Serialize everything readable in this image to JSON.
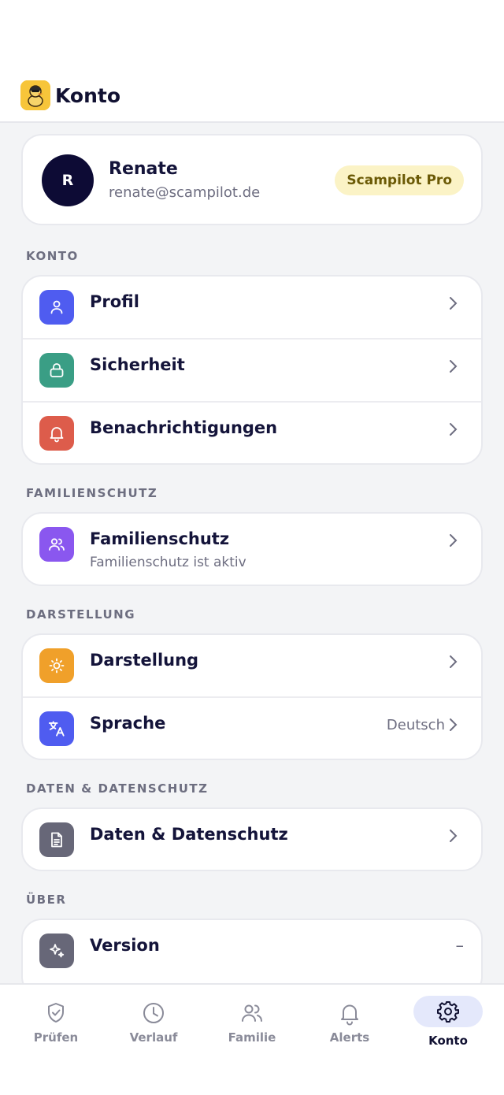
{
  "app": {
    "title": "Konto",
    "logo_icon": "duck-logo-icon"
  },
  "profile": {
    "avatar_initial": "R",
    "name": "Renate",
    "email": "renate@scampilot.de",
    "badge": "Scampilot Pro"
  },
  "sections": {
    "konto": {
      "label": "KONTO",
      "items": [
        {
          "label": "Profil",
          "icon": "user-icon",
          "color": "#4f5cf0"
        },
        {
          "label": "Sicherheit",
          "icon": "lock-icon",
          "color": "#3a9e85"
        },
        {
          "label": "Benachrichtigungen",
          "icon": "bell-icon",
          "color": "#dd5c4b"
        }
      ]
    },
    "familie": {
      "label": "FAMILIENSCHUTZ",
      "items": [
        {
          "label": "Familienschutz",
          "sublabel": "Familienschutz ist aktiv",
          "icon": "users-icon",
          "color": "#8a57ef"
        }
      ]
    },
    "darstellung": {
      "label": "DARSTELLUNG",
      "items": [
        {
          "label": "Darstellung",
          "icon": "sun-icon",
          "color": "#f0a02a"
        },
        {
          "label": "Sprache",
          "value": "Deutsch",
          "icon": "translate-icon",
          "color": "#4f5cf0"
        }
      ]
    },
    "daten": {
      "label": "DATEN & DATENSCHUTZ",
      "items": [
        {
          "label": "Daten & Datenschutz",
          "icon": "document-icon",
          "color": "#676778"
        }
      ]
    },
    "ueber": {
      "label": "ÜBER",
      "items": [
        {
          "label": "Version",
          "value": "–",
          "icon": "sparkles-icon",
          "color": "#676778"
        }
      ]
    }
  },
  "nav": [
    {
      "label": "Prüfen",
      "icon": "shield-check-icon"
    },
    {
      "label": "Verlauf",
      "icon": "clock-icon"
    },
    {
      "label": "Familie",
      "icon": "users-icon"
    },
    {
      "label": "Alerts",
      "icon": "bell-icon"
    },
    {
      "label": "Konto",
      "icon": "gear-icon",
      "active": true
    }
  ]
}
